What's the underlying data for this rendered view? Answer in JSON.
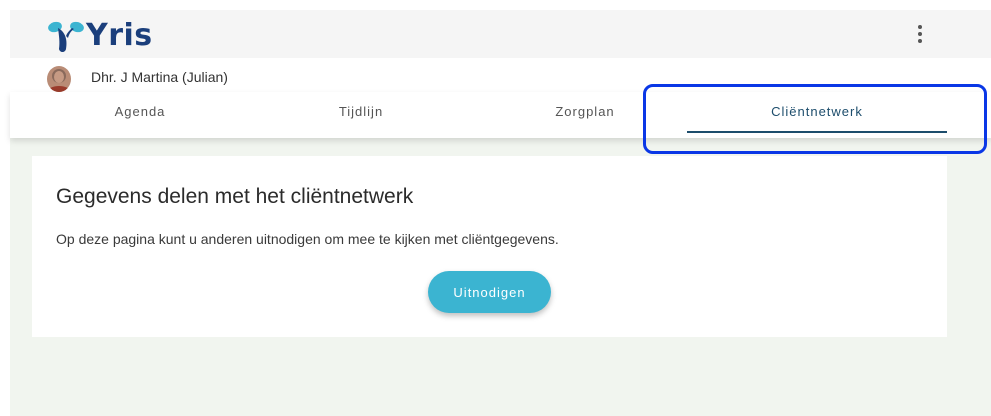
{
  "app": {
    "logo_text": "Yris",
    "brand_color": "#1b3f7c",
    "accent_color": "#3bb4d1",
    "menu_icon": "more-vertical-icon"
  },
  "client": {
    "name": "Dhr. J Martina (Julian)",
    "avatar_icon": "client-avatar"
  },
  "tabs": [
    {
      "label": "Agenda",
      "active": false
    },
    {
      "label": "Tijdlijn",
      "active": false
    },
    {
      "label": "Zorgplan",
      "active": false
    },
    {
      "label": "Cliëntnetwerk",
      "active": true
    }
  ],
  "highlight": {
    "color": "#0a37e6",
    "target": "Cliëntnetwerk"
  },
  "main": {
    "title": "Gegevens delen met het cliëntnetwerk",
    "description": "Op deze pagina kunt u anderen uitnodigen om mee te kijken met cliëntgegevens.",
    "invite_label": "Uitnodigen"
  }
}
